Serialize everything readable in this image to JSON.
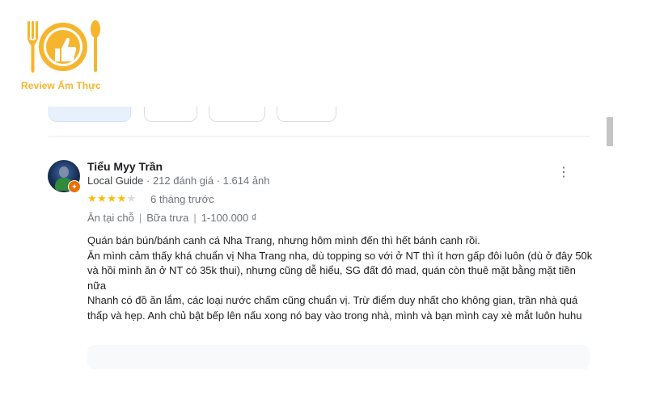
{
  "logo": {
    "text": "Review Ẩm Thực",
    "icon": "fork-plate-thumbs-up-spoon-icon",
    "color": "#f5b52e"
  },
  "filter_chips": [
    "",
    "",
    "",
    ""
  ],
  "review": {
    "author": "Tiểu Myy Trần",
    "guide_label": "Local Guide",
    "stats": " · 212 đánh giá · 1.614 ảnh",
    "rating": 4,
    "rating_max": 5,
    "time": "6 tháng trước",
    "tags": [
      "Ăn tại chỗ",
      "Bữa trưa",
      "1-100.000 ₫"
    ],
    "paragraphs": [
      "Quán bán bún/bánh canh cá Nha Trang, nhưng hôm mình đến thì hết bánh canh rồi.",
      "Ăn mình cảm thấy khá chuẩn vị Nha Trang nha, dù topping so với ở NT thì ít hơn gấp đôi luôn (dù ở đây 50k và hồi mình ăn ở NT có 35k thui), nhưng cũng dễ hiểu, SG đất đỏ mad, quán còn thuê mặt bằng mặt tiền nữa",
      "Nhanh có đồ ăn lắm, các loại nước chấm cũng chuẩn vị. Trừ điểm duy nhất cho không gian, trần nhà quá thấp và hẹp. Anh chủ bật bếp lên nấu xong nó bay vào trong nhà, mình và bạn mình cay xè mắt luôn huhu"
    ]
  },
  "colors": {
    "star_on": "#fbbc04",
    "star_off": "#dadce0",
    "badge": "#e8710a"
  }
}
